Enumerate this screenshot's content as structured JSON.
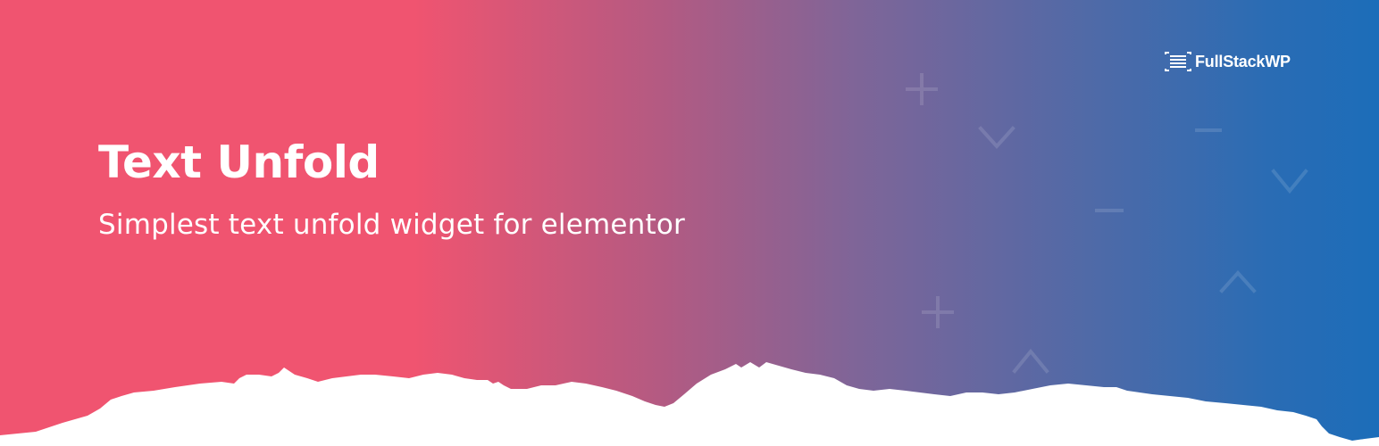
{
  "brand": {
    "logo_text": "FullStackWP",
    "logo_icon": "document-lines-icon"
  },
  "hero": {
    "title": "Text Unfold",
    "subtitle": "Simplest text unfold widget for elementor"
  },
  "colors": {
    "gradient_start": "#f05470",
    "gradient_end": "#1c6db9",
    "text": "#ffffff",
    "torn_edge": "#ffffff"
  }
}
